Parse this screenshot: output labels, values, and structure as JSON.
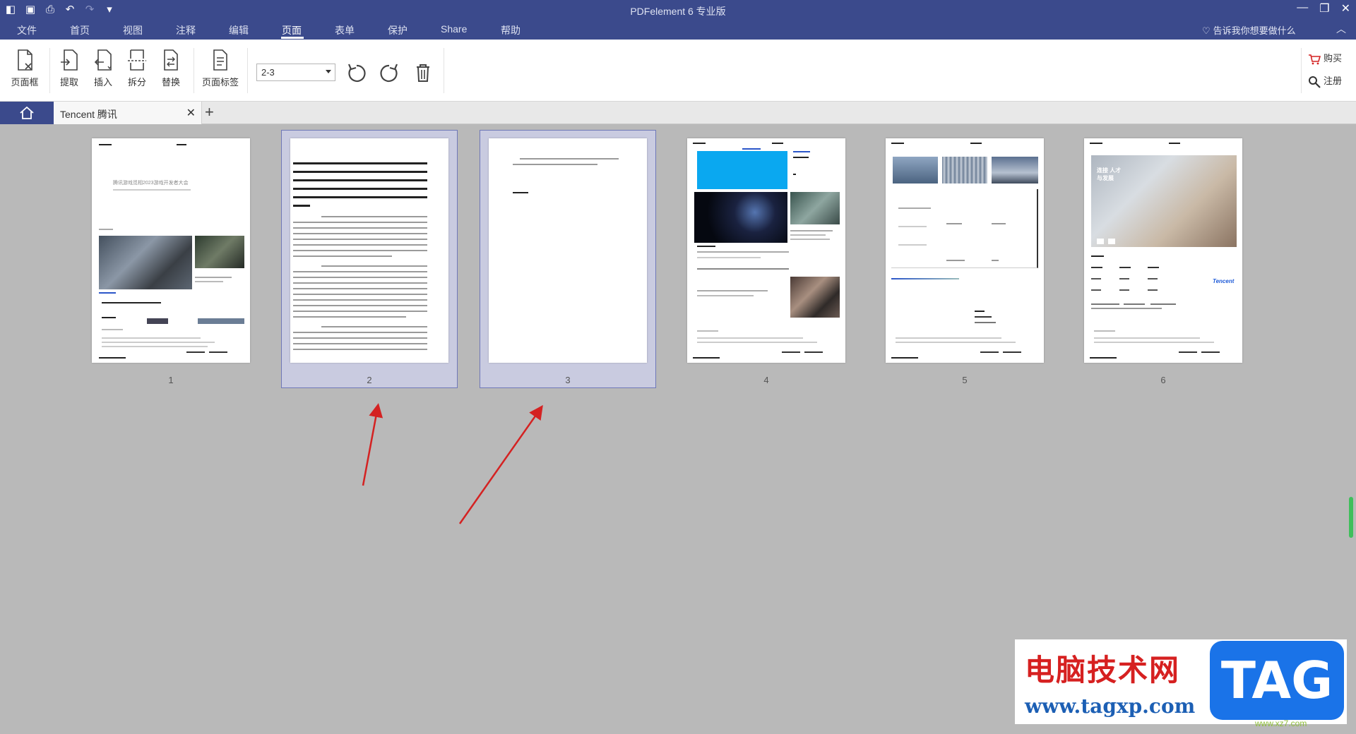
{
  "window": {
    "title": "PDFelement  6 专业版"
  },
  "menu": [
    "文件",
    "首页",
    "视图",
    "注释",
    "编辑",
    "页面",
    "表单",
    "保护",
    "Share",
    "帮助"
  ],
  "active_menu": "页面",
  "help_search": "告诉我你想要做什么",
  "toolbar": {
    "page_box": "页面框",
    "extract": "提取",
    "insert": "插入",
    "split": "拆分",
    "replace": "替换",
    "page_label": "页面标签",
    "range_value": "2-3",
    "buy": "购买",
    "register": "注册"
  },
  "tab": {
    "name": "Tencent 腾讯"
  },
  "pages": [
    {
      "num": "1",
      "selected": false,
      "heading": "腾讯游戏觅相2023游戏开发者大会"
    },
    {
      "num": "2",
      "selected": true
    },
    {
      "num": "3",
      "selected": true
    },
    {
      "num": "4",
      "selected": false
    },
    {
      "num": "5",
      "selected": false
    },
    {
      "num": "6",
      "selected": false,
      "title": "连接 人才与发展",
      "logo": "Tencent"
    }
  ],
  "watermark": {
    "title": "电脑技术网",
    "url": "www.tagxp.com",
    "tag": "TAG",
    "small": "www.xz7.com"
  },
  "colors": {
    "brand": "#3b4a8c",
    "selection": "#c9cbe0",
    "arrow": "#d42222"
  }
}
